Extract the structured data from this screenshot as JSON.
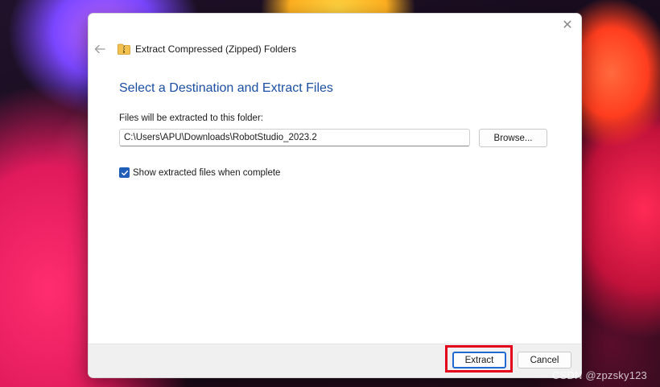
{
  "window": {
    "title": "Extract Compressed (Zipped) Folders",
    "close_glyph": "✕"
  },
  "main": {
    "heading": "Select a Destination and Extract Files",
    "folder_label": "Files will be extracted to this folder:",
    "path_value": "C:\\Users\\APU\\Downloads\\RobotStudio_2023.2",
    "browse_label": "Browse...",
    "show_files_label": "Show extracted files when complete",
    "show_files_checked": true
  },
  "footer": {
    "extract_label": "Extract",
    "cancel_label": "Cancel"
  },
  "watermark": "CSDN @zpzsky123",
  "colors": {
    "accent": "#1f5fb8",
    "heading": "#1b4fa3",
    "highlight": "#e3001b"
  },
  "icons": [
    "back-arrow-icon",
    "zip-folder-icon",
    "close-icon",
    "checkmark-icon"
  ]
}
